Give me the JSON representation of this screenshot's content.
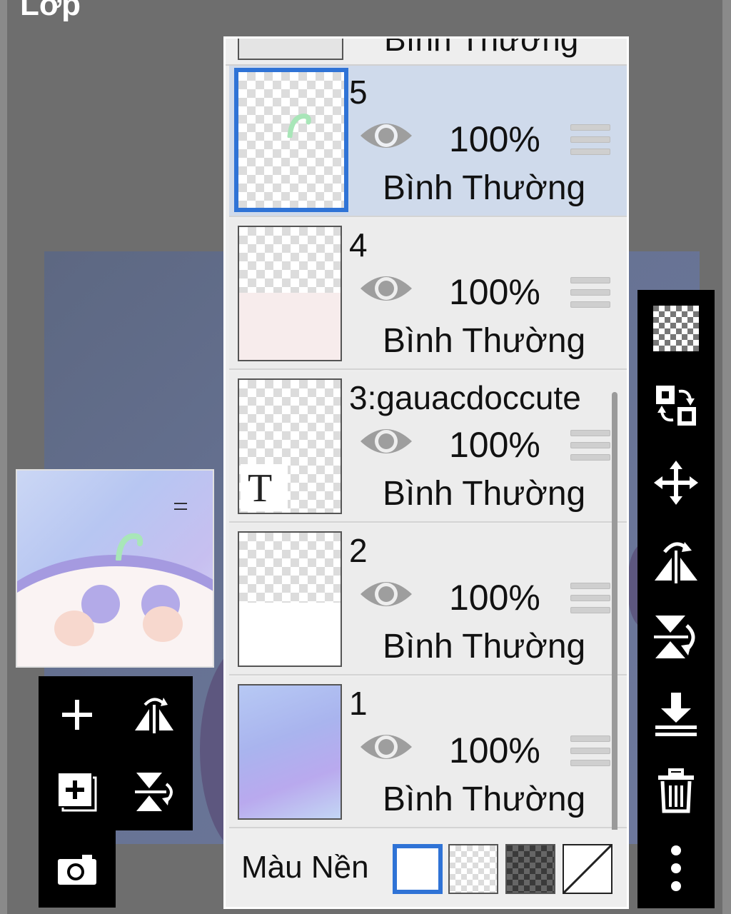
{
  "window": {
    "title": "Lớp"
  },
  "layers_panel": {
    "top_partial_layer": {
      "mode": "Bình Thường"
    },
    "layers": [
      {
        "name": "5",
        "opacity": "100%",
        "mode": "Bình Thường",
        "selected": true,
        "visible": true
      },
      {
        "name": "4",
        "opacity": "100%",
        "mode": "Bình Thường",
        "selected": false,
        "visible": true
      },
      {
        "name": "3:gauacdoccute",
        "opacity": "100%",
        "mode": "Bình Thường",
        "selected": false,
        "visible": true,
        "type_glyph": "T"
      },
      {
        "name": "2",
        "opacity": "100%",
        "mode": "Bình Thường",
        "selected": false,
        "visible": true
      },
      {
        "name": "1",
        "opacity": "100%",
        "mode": "Bình Thường",
        "selected": false,
        "visible": true
      }
    ],
    "background": {
      "label": "Màu Nền",
      "options": [
        "white",
        "checker-light",
        "checker-dark",
        "none"
      ],
      "selected": "white"
    }
  },
  "left_toolbar": [
    "add-layer-icon",
    "flip-horizontal-icon",
    "add-layer-copy-icon",
    "flip-vertical-icon",
    "camera-icon"
  ],
  "right_toolbar": [
    "transparency-icon",
    "swap-layers-icon",
    "move-icon",
    "flip-horizontal-icon",
    "flip-vertical-icon",
    "merge-down-icon",
    "trash-icon",
    "more-vertical-icon"
  ],
  "colors": {
    "accent": "#2f73d6",
    "selected_row": "#cfdaeb",
    "panel": "#eeeeee",
    "toolbar": "#000000"
  }
}
